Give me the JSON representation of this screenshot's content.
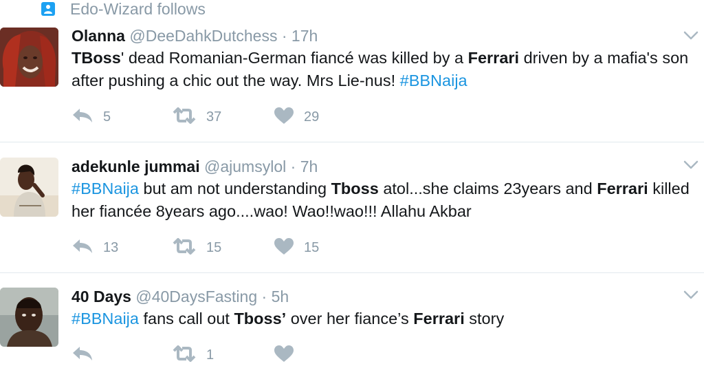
{
  "context": {
    "label": "Edo-Wizard follows",
    "icon": "person-icon"
  },
  "tweets": [
    {
      "name": "Olanna",
      "handle": "@DeeDahkDutchess",
      "sep": "·",
      "time": "17h",
      "text": [
        {
          "t": "TBoss",
          "b": true
        },
        {
          "t": "' dead Romanian-German fiancé was killed by a "
        },
        {
          "t": "Ferrari",
          "b": true
        },
        {
          "t": " driven by a mafia's son after pushing a chic out the way. Mrs Lie-nus! "
        },
        {
          "t": "#BBNaija",
          "h": true
        }
      ],
      "replies": "5",
      "retweets": "37",
      "likes": "29"
    },
    {
      "name": "adekunle jummai",
      "handle": "@ajumsylol",
      "sep": "·",
      "time": "7h",
      "text": [
        {
          "t": "#BBNaija",
          "h": true
        },
        {
          "t": " but am not understanding "
        },
        {
          "t": "Tboss",
          "b": true
        },
        {
          "t": " atol...she claims 23years and "
        },
        {
          "t": "Ferrari",
          "b": true
        },
        {
          "t": " killed her fiancée 8years ago....wao! Wao!!wao!!! Allahu Akbar"
        }
      ],
      "replies": "13",
      "retweets": "15",
      "likes": "15"
    },
    {
      "name": "40 Days",
      "handle": "@40DaysFasting",
      "sep": "·",
      "time": "5h",
      "text": [
        {
          "t": "#BBNaija",
          "h": true
        },
        {
          "t": " fans call out "
        },
        {
          "t": "Tboss",
          "b": true
        },
        {
          "t": "’",
          "b": true
        },
        {
          "t": " over her fiance’s "
        },
        {
          "t": "Ferrari",
          "b": true
        },
        {
          "t": " story"
        }
      ],
      "replies": "",
      "retweets": "1",
      "likes": ""
    }
  ],
  "colors": {
    "hashtag": "#1b95e0",
    "meta": "#8899a6",
    "icon": "#aab8c2",
    "divider": "#e1e8ed",
    "accent": "#1da1f2"
  }
}
